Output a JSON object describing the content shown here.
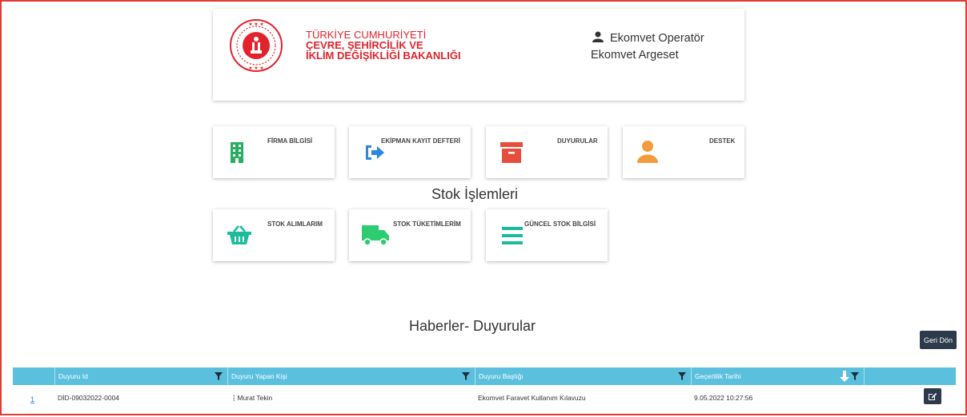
{
  "header": {
    "ministry_line1": "TÜRKİYE CUMHURİYETİ",
    "ministry_line2": "ÇEVRE, ŞEHİRCİLİK VE",
    "ministry_line3": "İKLİM DEĞİŞİKLİĞİ BAKANLIĞI",
    "user_name": "Ekomvet Operatör",
    "user_org": "Ekomvet Argeset"
  },
  "menu": [
    {
      "label": "FİRMA BİLGİSİ",
      "icon": "building-icon",
      "color": "#27ae60"
    },
    {
      "label": "EKİPMAN KAYIT DEFTERİ",
      "icon": "sign-in-icon",
      "color": "#2e86de"
    },
    {
      "label": "DUYURULAR",
      "icon": "archive-box-icon",
      "color": "#e74c3c"
    },
    {
      "label": "DESTEK",
      "icon": "user-icon",
      "color": "#f39c3c"
    }
  ],
  "stock_section": {
    "title": "Stok İşlemleri",
    "items": [
      {
        "label": "STOK ALIMLARIM",
        "icon": "basket-icon",
        "color": "#1abc9c"
      },
      {
        "label": "STOK TÜKETİMLERİM",
        "icon": "truck-icon",
        "color": "#2ecc71"
      },
      {
        "label": "GÜNCEL STOK BİLGİSİ",
        "icon": "list-icon",
        "color": "#1abc9c"
      }
    ]
  },
  "news": {
    "title": "Haberler- Duyurular",
    "back_label": "Geri Dön",
    "columns": [
      "Duyuru Id",
      "Duyuru Yapan Kişi",
      "Duyuru Başlığı",
      "Geçerlilik Tarihi"
    ],
    "rows": [
      {
        "index": "1",
        "id": "DİD-09032022-0004",
        "author": "Murat Tekin",
        "subject": "Ekomvet Faravet Kullanım Kılavuzu",
        "valid_date": "9.05.2022 10:27:56"
      }
    ]
  },
  "colors": {
    "border": "#e53935",
    "brand_red": "#e2232c",
    "grid_header": "#5bc0de",
    "dark_button": "#2c3a4b"
  }
}
